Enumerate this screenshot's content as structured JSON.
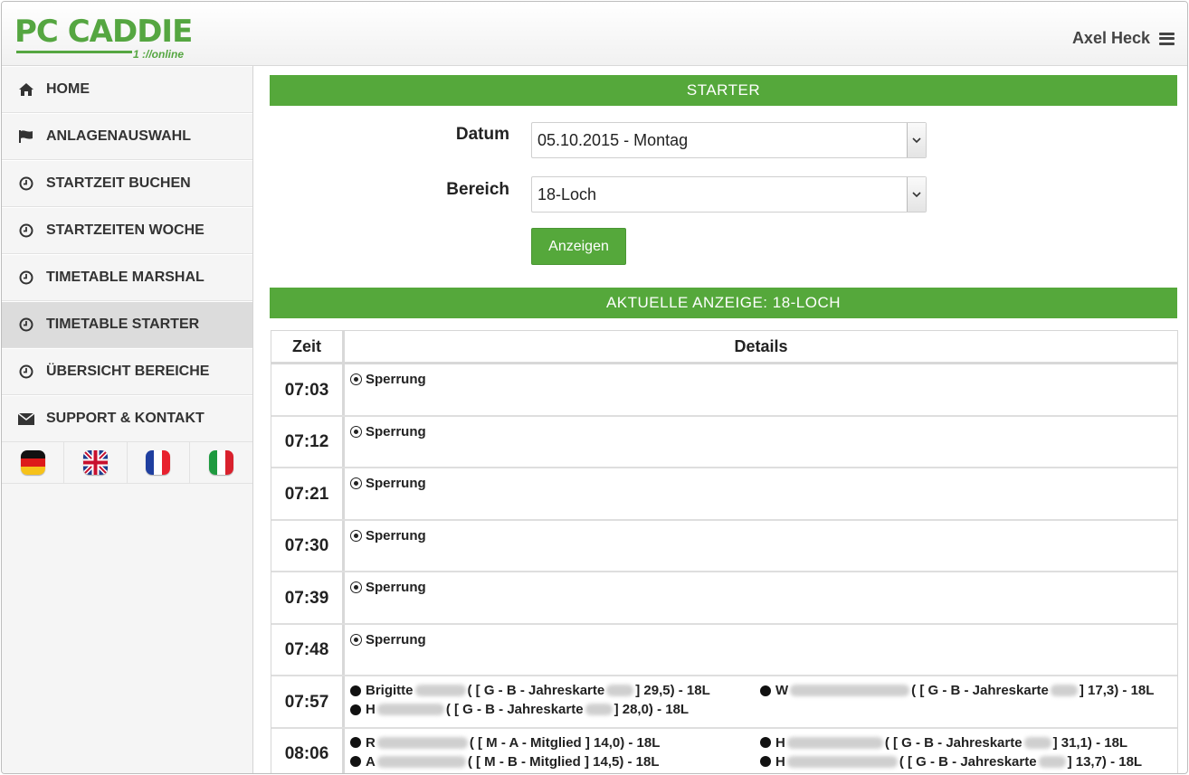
{
  "header": {
    "logo_main": "PC CADDIE",
    "logo_sub": "1 ://online",
    "user_name": "Axel Heck"
  },
  "sidebar": {
    "items": [
      {
        "label": "HOME",
        "icon": "home-icon"
      },
      {
        "label": "ANLAGENAUSWAHL",
        "icon": "flag-icon"
      },
      {
        "label": "STARTZEIT BUCHEN",
        "icon": "clock-icon"
      },
      {
        "label": "STARTZEITEN WOCHE",
        "icon": "clock-icon"
      },
      {
        "label": "TIMETABLE MARSHAL",
        "icon": "clock-icon"
      },
      {
        "label": "TIMETABLE STARTER",
        "icon": "clock-icon",
        "active": true
      },
      {
        "label": "ÜBERSICHT BEREICHE",
        "icon": "clock-icon"
      },
      {
        "label": "SUPPORT & KONTAKT",
        "icon": "envelope-icon"
      }
    ],
    "languages": [
      "de",
      "en",
      "fr",
      "it"
    ]
  },
  "main": {
    "title": "STARTER",
    "form": {
      "date_label": "Datum",
      "date_value": "05.10.2015 - Montag",
      "area_label": "Bereich",
      "area_value": "18-Loch",
      "submit_label": "Anzeigen"
    },
    "current_display": "AKTUELLE ANZEIGE: 18-LOCH",
    "table": {
      "headers": {
        "time": "Zeit",
        "details": "Details"
      },
      "rows": [
        {
          "time": "07:03",
          "text": "Sperrung"
        },
        {
          "time": "07:12",
          "text": "Sperrung"
        },
        {
          "time": "07:21",
          "text": "Sperrung"
        },
        {
          "time": "07:30",
          "text": "Sperrung"
        },
        {
          "time": "07:39",
          "text": "Sperrung"
        },
        {
          "time": "07:48",
          "text": "Sperrung"
        },
        {
          "time": "07:57"
        },
        {
          "time": "08:06"
        }
      ],
      "players_0757": [
        {
          "first": "Brigitte",
          "info": "( [ G - B - Jahreskarte",
          "tail": "] 29,5) - 18L"
        },
        {
          "first": "W",
          "info": "( [ G - B - Jahreskarte",
          "tail": "] 17,3) - 18L"
        },
        {
          "first": "H",
          "info": "( [ G - B - Jahreskarte",
          "tail": "] 28,0) - 18L"
        }
      ],
      "players_0806": [
        {
          "first": "R",
          "info": "( [ M - A - Mitglied ] 14,0) - 18L"
        },
        {
          "first": "H",
          "info": "( [ G - B - Jahreskarte",
          "tail": "] 31,1) - 18L"
        },
        {
          "first": "A",
          "info": "( [ M - B - Mitglied ] 14,5) - 18L"
        },
        {
          "first": "H",
          "info": "( [ G - B - Jahreskarte",
          "tail": "] 13,7) - 18L"
        }
      ]
    }
  },
  "colors": {
    "accent": "#55a83b",
    "logo": "#55a641"
  }
}
